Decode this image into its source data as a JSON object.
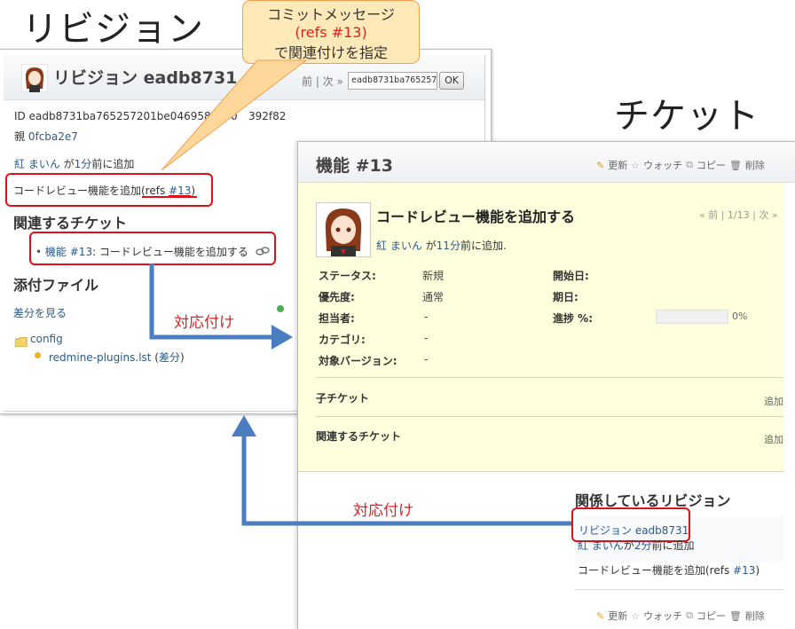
{
  "headings": {
    "left": "リビジョン",
    "right": "チケット"
  },
  "callout": {
    "line1": "コミットメッセージ",
    "line2": "(refs #13)",
    "line3": "で関連付けを指定"
  },
  "arrows": {
    "label1": "対応付け",
    "label2": "対応付け"
  },
  "revision": {
    "title": "リビジョン eadb8731",
    "nav": "前 | 次 »",
    "search_value": "eadb8731ba765257",
    "ok_label": "OK",
    "id_label": "ID",
    "id_value": "eadb8731ba765257201be046958eab0",
    "id_value_tail": "392f82",
    "parent_label": "親",
    "parent_value": "0fcba2e7",
    "author": "紅 まいん",
    "author_suffix": "が",
    "time": "1分",
    "time_suffix": "前に追加",
    "message_prefix": "コードレビュー機能を追加(refs ",
    "message_ref": "#13",
    "message_suffix": ")",
    "related_heading": "関連するチケット",
    "related_tracker": "機能",
    "related_ref": "#13",
    "related_text": ": コードレビュー機能を追加する",
    "attachments_heading": "添付ファイル",
    "diff_link": "差分を見る",
    "folder": "config",
    "file": "redmine-plugins.lst",
    "file_diff": "差分"
  },
  "ticket": {
    "title": "機能 #13",
    "actions": {
      "edit": "更新",
      "watch": "ウォッチ",
      "copy": "コピー",
      "delete": "削除"
    },
    "subject": "コードレビュー機能を追加する",
    "nav": "« 前 | 1/13 | 次 »",
    "author": "紅 まいん",
    "author_suffix": "が",
    "time": "11分",
    "time_suffix": "前に追加.",
    "fields": {
      "status_label": "ステータス:",
      "status_value": "新規",
      "priority_label": "優先度:",
      "priority_value": "通常",
      "assignee_label": "担当者:",
      "assignee_value": "-",
      "category_label": "カテゴリ:",
      "category_value": "-",
      "version_label": "対象バージョン:",
      "version_value": "-",
      "start_label": "開始日:",
      "due_label": "期日:",
      "progress_label": "進捗 %:",
      "progress_value": "0%"
    },
    "progress_fraction": 0,
    "subtasks_label": "子チケット",
    "subtasks_add": "追加",
    "relations_label": "関連するチケット",
    "relations_add": "追加",
    "revisions_heading": "関係しているリビジョン",
    "revision_link": "リビジョン eadb8731",
    "revision_author": "紅 まいん",
    "revision_author_suffix": "が",
    "revision_time": "2分",
    "revision_time_suffix": "前に追加",
    "revision_message_prefix": "コードレビュー機能を追加(refs ",
    "revision_message_ref": "#13",
    "revision_message_suffix": ")"
  },
  "colors": {
    "highlight": "#e0101a",
    "arrow": "#4a7ec0",
    "callout_bg": "#ffe9b8",
    "ticket_bg": "#ffffdd"
  }
}
